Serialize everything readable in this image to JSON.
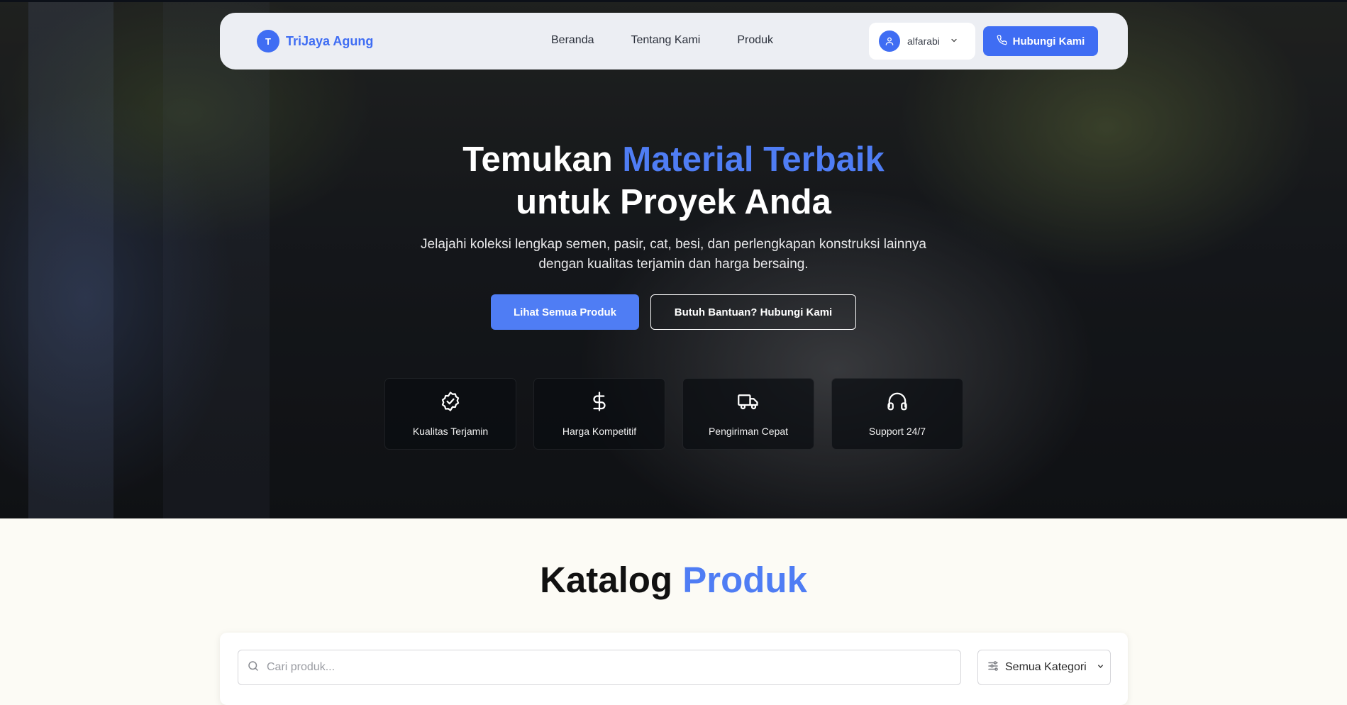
{
  "brand": {
    "initial": "T",
    "name": "TriJaya Agung"
  },
  "nav": {
    "links": [
      "Beranda",
      "Tentang Kami",
      "Produk"
    ],
    "user": "alfarabi",
    "contact_label": "Hubungi Kami"
  },
  "hero": {
    "title_part1": "Temukan ",
    "title_accent": "Material Terbaik",
    "title_line2": "untuk Proyek Anda",
    "subtitle_line1": "Jelajahi koleksi lengkap semen, pasir, cat, besi, dan perlengkapan konstruksi lainnya",
    "subtitle_line2": "dengan kualitas terjamin dan harga bersaing.",
    "primary_btn": "Lihat Semua Produk",
    "secondary_btn": "Butuh Bantuan? Hubungi Kami",
    "features": [
      {
        "icon": "badge-check-icon",
        "label": "Kualitas Terjamin"
      },
      {
        "icon": "dollar-icon",
        "label": "Harga Kompetitif"
      },
      {
        "icon": "truck-icon",
        "label": "Pengiriman Cepat"
      },
      {
        "icon": "headphones-icon",
        "label": "Support 24/7"
      }
    ]
  },
  "catalog": {
    "title_part1": "Katalog ",
    "title_accent": "Produk",
    "search_placeholder": "Cari produk...",
    "category_value": "Semua Kategori"
  },
  "colors": {
    "accent": "#4f7df4",
    "brand": "#3f6df3"
  }
}
